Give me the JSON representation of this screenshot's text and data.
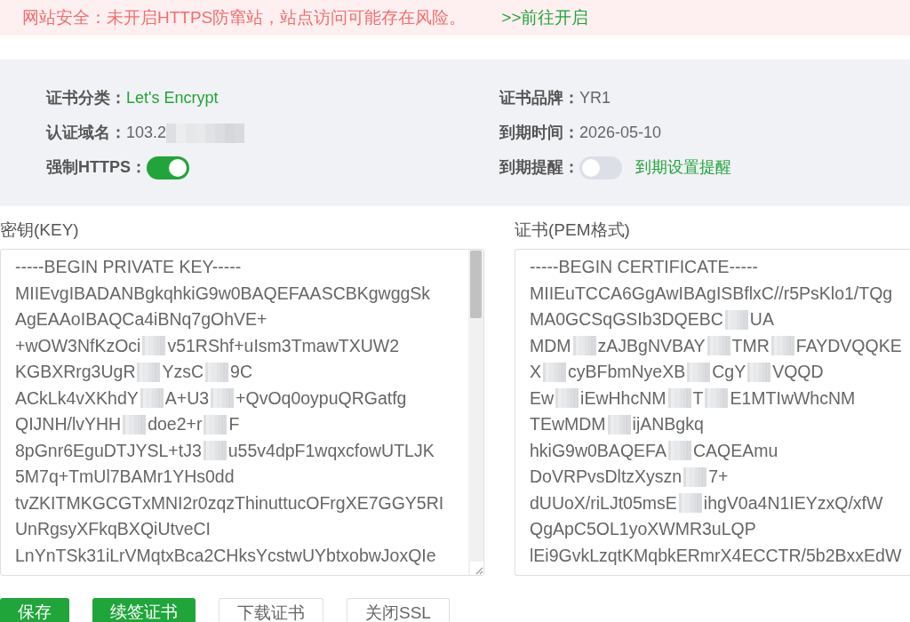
{
  "banner": {
    "message": "网站安全：未开启HTTPS防窜站，站点访问可能存在风险。",
    "link": ">>前往开启"
  },
  "cert_info": {
    "fields": [
      {
        "kind": "text",
        "label": "证书分类：",
        "value": "Let's Encrypt",
        "accent": true,
        "redacted": false
      },
      {
        "kind": "text",
        "label": "证书品牌：",
        "value": "YR1",
        "accent": false,
        "redacted": false
      },
      {
        "kind": "text",
        "label": "认证域名：",
        "value": "103.2",
        "accent": false,
        "redacted": true
      },
      {
        "kind": "text",
        "label": "到期时间：",
        "value": "2026-05-10",
        "accent": false,
        "redacted": false
      },
      {
        "kind": "switch",
        "label": "强制HTTPS：",
        "on": true
      },
      {
        "kind": "switch",
        "label": "到期提醒：",
        "on": false,
        "link": "到期设置提醒"
      }
    ]
  },
  "key": {
    "label": "密钥(KEY)",
    "lines": [
      [
        "-----BEGIN PRIVATE KEY-----"
      ],
      [
        "MIIEvgIBADANBgkqhkiG9w0BAQEFAASCBKgwggSk"
      ],
      [
        "AgEAAoIBAQCa4iBNq7gOhVE+"
      ],
      [
        "+wOW3NfKzOci",
        "v51RShf+uIsm3TmawTXUW2"
      ],
      [
        "KGBXRrg3UgR",
        "YzsC",
        "9C"
      ],
      [
        "ACkLk4vXKhdY",
        "A+U3",
        "+QvOq0oypuQRGatfg"
      ],
      [
        "QIJNH/lvYHH",
        "doe2+r",
        "F"
      ],
      [
        "8pGnr6EguDTJYSL+tJ3",
        "u55v4dpF1wqxcfowUTLJK"
      ],
      [
        "5M7q+TmUl7BAMr1YHs0dd"
      ],
      [
        "tvZKITMKGCGTxMNI2r0zqzThinuttucOFrgXE7GGY5RI"
      ],
      [
        "UnRgsyXFkqBXQiUtveCI"
      ],
      [
        "LnYnTSk31iLrVMqtxBca2CHksYcstwUYbtxobwJoxQIe"
      ]
    ]
  },
  "certificate": {
    "label": "证书(PEM格式)",
    "lines": [
      [
        "-----BEGIN CERTIFICATE-----"
      ],
      [
        "MIIEuTCCA6GgAwIBAgISBflxC//r5PsKlo1/TQg"
      ],
      [
        "MA0GCSqGSIb3DQEBC",
        "UA"
      ],
      [
        "MDM",
        "zAJBgNVBAY",
        "TMR",
        "FAYDVQQKE"
      ],
      [
        "X",
        "cyBFbmNyeXB",
        "CgY",
        "VQQD"
      ],
      [
        "Ew",
        "iEwHhcNM",
        "T",
        "E1MTIwWhcNM"
      ],
      [
        "TEwMDM",
        "ijANBgkq"
      ],
      [
        "hkiG9w0BAQEFA",
        "CAQEAmu"
      ],
      [
        "DoVRPvsDltzXyszn",
        "7+"
      ],
      [
        "dUUoX/riLJt05msE",
        "ihgV0a4N1IEYzxQ/xfW"
      ],
      [
        "QgApC5OL1yoXWMR3uLQP"
      ],
      [
        "lEi9GvkLzqtKMqbkERmrX4ECCTR/5b2BxxEdW"
      ]
    ]
  },
  "buttons": [
    {
      "label": "保存",
      "primary": true
    },
    {
      "label": "续签证书",
      "primary": true
    },
    {
      "label": "下载证书",
      "primary": false
    },
    {
      "label": "关闭SSL",
      "primary": false
    }
  ]
}
